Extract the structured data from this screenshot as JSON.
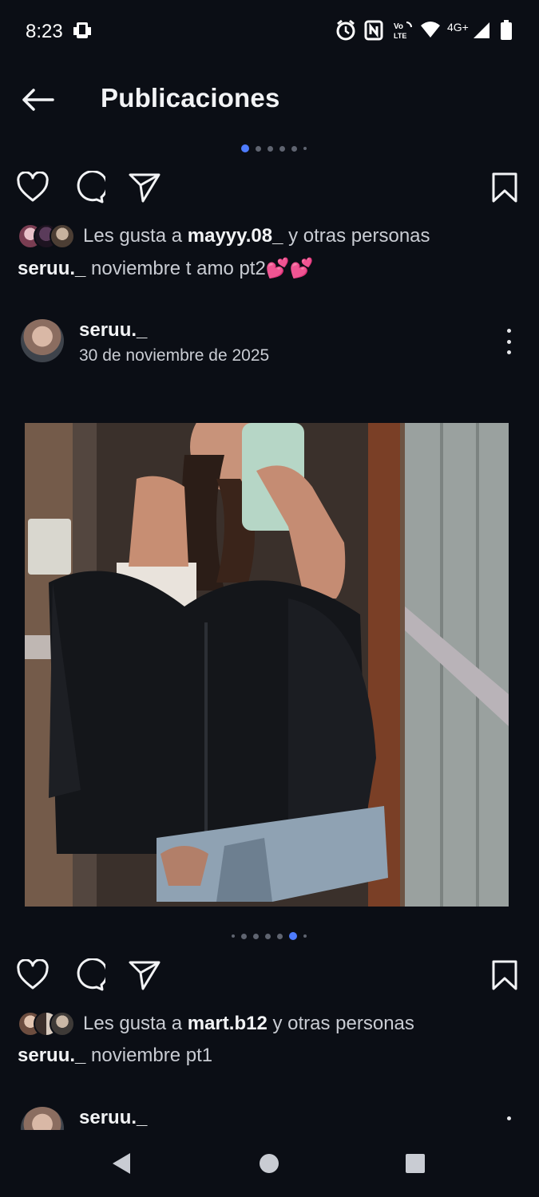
{
  "status_bar": {
    "time": "8:23",
    "network_label": "4G+",
    "icons": [
      "screenshot-icon",
      "alarm-icon",
      "nfc-icon",
      "volte-icon",
      "wifi-icon",
      "signal-icon",
      "battery-icon"
    ]
  },
  "header": {
    "title": "Publicaciones",
    "back_icon": "arrow-left-icon"
  },
  "posts": [
    {
      "carousel": {
        "count": 6,
        "active": 1
      },
      "likes": {
        "prefix": "Les gusta a ",
        "user": "mayyy.08_",
        "suffix": " y otras personas"
      },
      "caption": {
        "user": "seruu._",
        "text": " noviembre t amo pt2💕💕"
      }
    },
    {
      "author": "seruu._",
      "date": "30 de noviembre de 2025",
      "image_alt": "Selfie en espejo con chaqueta negra y short de jean",
      "carousel": {
        "count": 7,
        "active": 6
      },
      "likes": {
        "prefix": "Les gusta a ",
        "user": "mart.b12",
        "suffix": " y otras personas"
      },
      "caption": {
        "user": "seruu._",
        "text": " noviembre pt1"
      }
    },
    {
      "author": "seruu._"
    }
  ],
  "colors": {
    "background": "#0b0e15",
    "accent": "#4e7cff",
    "text_primary": "#f2f3f5",
    "text_secondary": "#c9ccd3"
  },
  "nav": {
    "icons": [
      "back-triangle-icon",
      "home-circle-icon",
      "recents-square-icon"
    ]
  }
}
